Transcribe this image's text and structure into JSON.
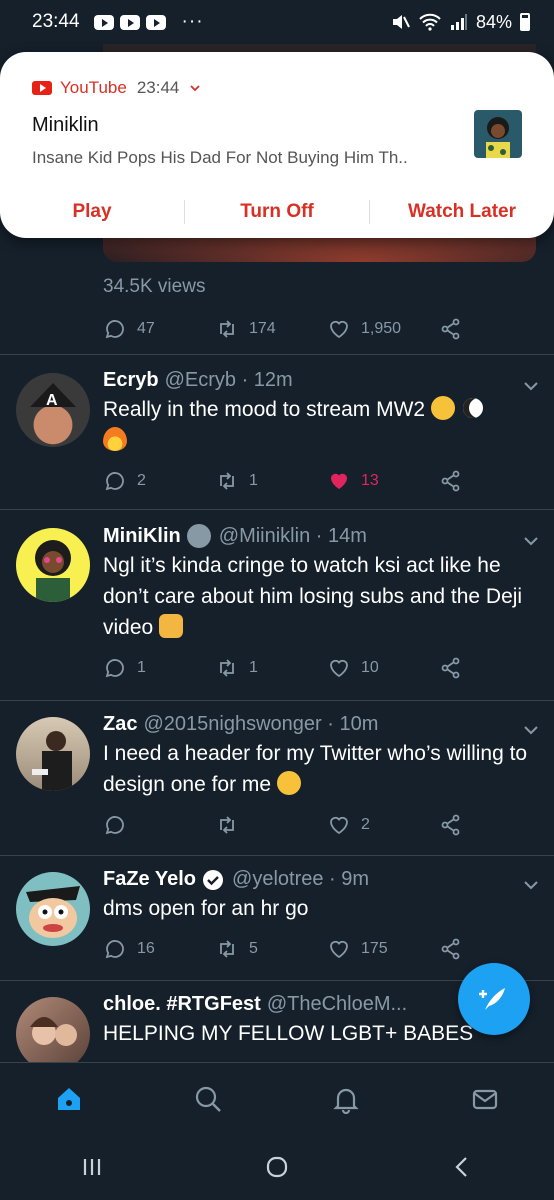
{
  "status_bar": {
    "time": "23:44",
    "battery": "84%",
    "more": "···"
  },
  "notification": {
    "app_name": "YouTube",
    "time": "23:44",
    "title": "Miniklin",
    "text": "Insane Kid Pops His Dad For Not Buying Him Th..",
    "actions": [
      "Play",
      "Turn Off",
      "Watch Later"
    ]
  },
  "video_tweet": {
    "views": "34.5K views",
    "replies": "47",
    "retweets": "174",
    "likes": "1,950"
  },
  "tweets": [
    {
      "name": "Ecryb",
      "handle": "@Ecryb · 12m",
      "text": "Really in the mood to stream MW2",
      "replies": "2",
      "retweets": "1",
      "likes": "13",
      "liked": true
    },
    {
      "name": "MiniKlin",
      "handle": "@Miiniklin · 14m",
      "text": "Ngl it’s kinda cringe to watch ksi act like he don’t care about him losing subs and the Deji video",
      "replies": "1",
      "retweets": "1",
      "likes": "10",
      "liked": false
    },
    {
      "name": "Zac",
      "handle": "@2015nighswonger · 10m",
      "text": "I need a header for my Twitter who’s willing to design one for me",
      "replies": "",
      "retweets": "",
      "likes": "2",
      "liked": false
    },
    {
      "name": "FaZe Yelo",
      "handle": "@yelotree · 9m",
      "text": "dms open for an hr go",
      "replies": "16",
      "retweets": "5",
      "likes": "175",
      "liked": false
    },
    {
      "name": "chloe. #RTGFest",
      "handle": "@TheChloeM...",
      "text": "HELPING MY FELLOW LGBT+ BABES",
      "replies": "",
      "retweets": "",
      "likes": "",
      "liked": false
    }
  ],
  "colors": {
    "background": "#15202b",
    "accent": "#1da1f2",
    "muted": "#8899a6",
    "like": "#e0245e",
    "youtube_red": "#d93025"
  }
}
